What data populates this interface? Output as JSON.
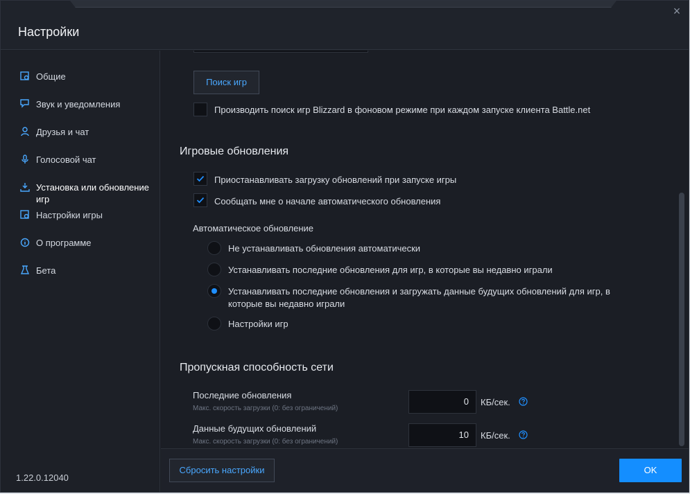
{
  "window": {
    "title": "Настройки",
    "close_glyph": "×"
  },
  "sidebar": {
    "items": [
      {
        "label": "Общие",
        "icon": "gear-window-icon"
      },
      {
        "label": "Звук и уведомления",
        "icon": "notification-icon"
      },
      {
        "label": "Друзья и чат",
        "icon": "person-icon"
      },
      {
        "label": "Голосовой чат",
        "icon": "microphone-icon"
      },
      {
        "label": "Установка или обновление игр",
        "icon": "download-icon",
        "active": true
      },
      {
        "label": "Настройки игры",
        "icon": "gear-window-icon"
      },
      {
        "label": "О программе",
        "icon": "info-icon"
      },
      {
        "label": "Бета",
        "icon": "flask-icon"
      }
    ],
    "version": "1.22.0.12040"
  },
  "games_search": {
    "button_label": "Поиск игр",
    "background_search_label": "Производить поиск игр Blizzard в фоновом режиме при каждом запуске клиента Battle.net",
    "background_search_checked": false
  },
  "game_updates": {
    "title": "Игровые обновления",
    "pause_downloads_label": "Приостанавливать загрузку обновлений при запуске игры",
    "pause_downloads_checked": true,
    "notify_label": "Сообщать мне о начале автоматического обновления",
    "notify_checked": true,
    "auto_update_title": "Автоматическое обновление",
    "options": [
      {
        "label": "Не устанавливать обновления автоматически",
        "selected": false
      },
      {
        "label": "Устанавливать последние обновления для игр, в которые вы недавно играли",
        "selected": false
      },
      {
        "label_line1": "Устанавливать последние обновления и загружать данные будущих обновлений для игр, в",
        "label_line2": "которые вы недавно играли",
        "selected": true
      },
      {
        "label": "Настройки игр",
        "selected": false
      }
    ]
  },
  "bandwidth": {
    "title": "Пропускная способность сети",
    "latest": {
      "label": "Последние обновления",
      "hint": "Макс. скорость загрузки (0: без ограничений)",
      "value": "0",
      "unit": "КБ/сек."
    },
    "future": {
      "label": "Данные будущих обновлений",
      "hint": "Макс. скорость загрузки (0: без ограничений)",
      "value": "10",
      "unit": "КБ/сек."
    }
  },
  "footer": {
    "reset_label": "Сбросить настройки",
    "ok_label": "OK"
  },
  "colors": {
    "accent": "#148eff",
    "link": "#4aa8ff",
    "background": "#1b1e25"
  }
}
